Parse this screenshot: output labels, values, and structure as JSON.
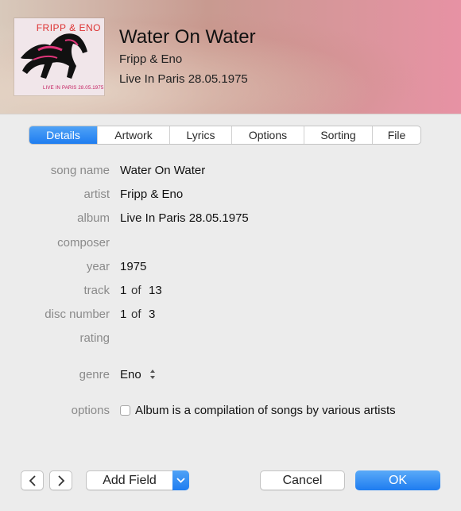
{
  "header": {
    "song_title": "Water On Water",
    "artist": "Fripp & Eno",
    "album": "Live In Paris 28.05.1975",
    "artwork": {
      "title": "FRIPP & ENO",
      "subtitle": "LIVE IN PARIS 28.05.1975"
    }
  },
  "tabs": [
    {
      "label": "Details",
      "active": true
    },
    {
      "label": "Artwork",
      "active": false
    },
    {
      "label": "Lyrics",
      "active": false
    },
    {
      "label": "Options",
      "active": false
    },
    {
      "label": "Sorting",
      "active": false
    },
    {
      "label": "File",
      "active": false
    }
  ],
  "fields": {
    "song_name": {
      "label": "song name",
      "value": "Water On Water"
    },
    "artist": {
      "label": "artist",
      "value": "Fripp & Eno"
    },
    "album": {
      "label": "album",
      "value": "Live In Paris 28.05.1975"
    },
    "composer": {
      "label": "composer",
      "value": ""
    },
    "year": {
      "label": "year",
      "value": "1975"
    },
    "track": {
      "label": "track",
      "number": "1",
      "of_label": "of",
      "total": "13"
    },
    "disc_number": {
      "label": "disc number",
      "number": "1",
      "of_label": "of",
      "total": "3"
    },
    "rating": {
      "label": "rating",
      "value": ""
    },
    "genre": {
      "label": "genre",
      "value": "Eno"
    },
    "options": {
      "label": "options",
      "checkbox_label": "Album is a compilation of songs by various artists",
      "checked": false
    }
  },
  "footer": {
    "prev_icon": "chevron-left-icon",
    "next_icon": "chevron-right-icon",
    "add_field_label": "Add Field",
    "cancel_label": "Cancel",
    "ok_label": "OK"
  },
  "colors": {
    "accent": "#1f7df0",
    "label_gray": "#8a8a8a"
  }
}
